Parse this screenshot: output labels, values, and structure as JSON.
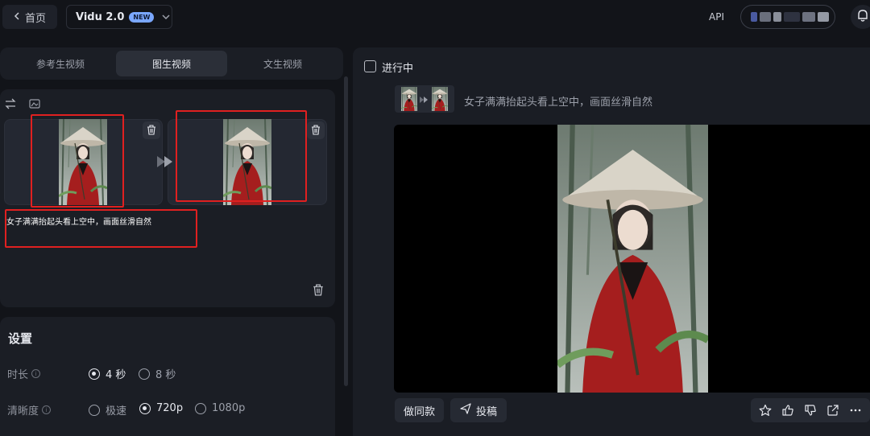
{
  "topbar": {
    "home_label": "首页",
    "model_name": "Vidu 2.0",
    "model_badge": "NEW",
    "api_label": "API"
  },
  "tabs": [
    {
      "label": "参考生视频",
      "active": false
    },
    {
      "label": "图生视频",
      "active": true
    },
    {
      "label": "文生视频",
      "active": false
    }
  ],
  "editor": {
    "prompt": "女子满满抬起头看上空中，画面丝滑自然"
  },
  "settings": {
    "title": "设置",
    "duration": {
      "label": "时长",
      "options": [
        "4 秒",
        "8 秒"
      ],
      "selected": "4 秒"
    },
    "resolution": {
      "label": "清晰度",
      "options": [
        "极速",
        "720p",
        "1080p"
      ],
      "selected": "720p"
    }
  },
  "result": {
    "status": "进行中",
    "prompt": "女子满满抬起头看上空中，画面丝滑自然",
    "make_same_label": "做同款",
    "submit_label": "投稿"
  },
  "colors": {
    "background": "#121419",
    "panel": "#1b1e25",
    "highlight_box": "#e02020",
    "accent_badge": "#7aa7ff"
  }
}
